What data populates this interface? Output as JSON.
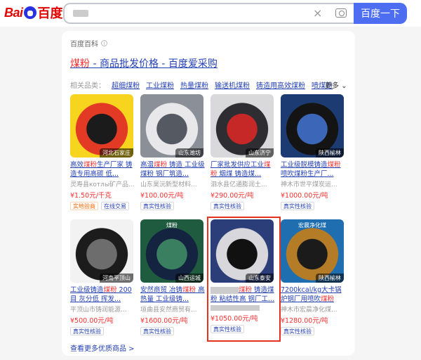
{
  "header": {
    "logo_bai": "Bai",
    "logo_du": "百度",
    "search_button": "百度一下",
    "clear_icon": "×"
  },
  "result": {
    "source": "百度百科",
    "title_highlight": "煤粉",
    "title_rest": " - 商品批发价格 - 百度爱采购",
    "category_label": "相关品类：",
    "categories": [
      "超细煤粉",
      "工业煤粉",
      "热量煤粉",
      "输送机煤粉",
      "铸造用高效煤粉",
      "喷煤粉"
    ],
    "more": "更多",
    "see_more": "查看更多优质商品 >"
  },
  "products": [
    {
      "location": "河北石家庄",
      "title_pre": "高效",
      "title_hl": "煤粉",
      "title_post": "生产厂家 铸造专用高碳 低...",
      "company": "灵寿县котлы矿产品...",
      "price": "¥1.50元/千克",
      "tags": [
        "实地验商",
        "在线交易"
      ],
      "thumb_colors": [
        "#f7d51e",
        "#e23a24",
        "#1b1b1b"
      ]
    },
    {
      "location": "山东潍坊",
      "title_pre": "高温",
      "title_hl": "煤粉",
      "title_post": " 铸造 工业级煤粉 钢厂筑造...",
      "company": "山东昊沅新型材料...",
      "price": "¥100.00元/吨",
      "tags": [
        "真实性核验"
      ],
      "thumb_colors": [
        "#8b8f97",
        "#e8e8ea",
        "#555a62"
      ]
    },
    {
      "location": "山东济宁",
      "title_pre": "厂家批发供应工业",
      "title_hl": "煤粉",
      "title_post": " 烟煤 铸造煤...",
      "company": "泗水县亿通膨润土...",
      "price": "¥290.00元/吨",
      "tags": [
        "真实性核验"
      ],
      "thumb_colors": [
        "#d9d9dc",
        "#2e2e32",
        "#c62828"
      ]
    },
    {
      "location": "陕西榆林",
      "title_pre": "工业级脱模铸造",
      "title_hl": "煤粉",
      "title_post": " 喷吹煤粉生产厂...",
      "company": "神木市世平煤炭运...",
      "price": "¥1000.00元/吨",
      "tags": [
        "真实性核验"
      ],
      "thumb_colors": [
        "#1d3b73",
        "#141414",
        "#3c66b8"
      ]
    },
    {
      "location": "河南平顶山",
      "title_pre": "工业级铸造",
      "title_hl": "煤粉",
      "title_post": " 200目 灰分低 挥发...",
      "company": "平顶山市铸润能源...",
      "price": "¥500.00元/吨",
      "tags": [
        "真实性核验"
      ],
      "thumb_colors": [
        "#f2f2f2",
        "#1c1c1c",
        "#6d6d6d"
      ]
    },
    {
      "location": "山西运城",
      "title_pre": "安然商贸 冶铸",
      "title_hl": "煤粉",
      "title_post": " 高热量 工业级铸...",
      "company": "垣曲县安然商贸有...",
      "price": "¥1600.00元/吨",
      "tags": [
        "真实性核验"
      ],
      "thumb_colors": [
        "#1f5c3f",
        "#14233f",
        "#3a8060"
      ],
      "badge": "煤粉"
    },
    {
      "location": "山东泰安",
      "title_pre": "",
      "title_hl": "煤粉",
      "title_post": " 铸造煤粉 粘结性高 钢厂工...",
      "company": "",
      "price": "¥1050.00元/吨",
      "tags": [
        "真实性核验"
      ],
      "thumb_colors": [
        "#2c3e7a",
        "#d8d8dc",
        "#111111"
      ],
      "blurred": true
    },
    {
      "location": "陕西榆林",
      "title_pre": "7200kcal/kg大卡锅炉钢厂用喷吹",
      "title_hl": "煤粉",
      "title_post": "",
      "company": "神木市宏晨净化煤...",
      "price": "¥1280.00元/吨",
      "tags": [
        "真实性核验"
      ],
      "thumb_colors": [
        "#1f6fb0",
        "#b57c28",
        "#1b1b1b"
      ],
      "badge": "宏晨净化煤"
    }
  ]
}
